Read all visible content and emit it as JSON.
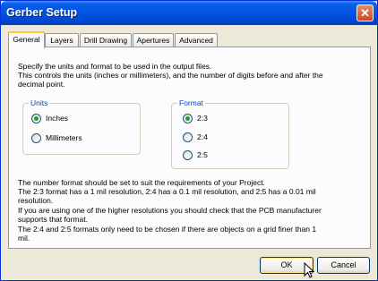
{
  "window": {
    "title": "Gerber Setup"
  },
  "tabs": [
    {
      "label": "General"
    },
    {
      "label": "Layers"
    },
    {
      "label": "Drill Drawing"
    },
    {
      "label": "Apertures"
    },
    {
      "label": "Advanced"
    }
  ],
  "general": {
    "intro_line1": "Specify the units and format to be used in the output files.",
    "intro_line2": "This controls the units (inches or millimeters), and the number of digits before and after the",
    "intro_line3": "decimal point.",
    "units": {
      "label": "Units",
      "options": [
        {
          "label": "Inches",
          "checked": true
        },
        {
          "label": "Millimeters",
          "checked": false
        }
      ]
    },
    "format": {
      "label": "Format",
      "options": [
        {
          "label": "2:3",
          "checked": true
        },
        {
          "label": "2:4",
          "checked": false
        },
        {
          "label": "2:5",
          "checked": false
        }
      ]
    },
    "info_lines": [
      "The number format should be set to suit the requirements of your Project.",
      "The 2:3 format has a 1 mil resolution, 2:4 has a 0.1 mil resolution, and 2:5 has a 0.01 mil",
      "resolution.",
      "If you are using one of the higher resolutions you should check that the PCB manufacturer",
      "supports that format.",
      "The 2:4 and 2:5 formats only need to be chosen if there are objects on a grid finer than 1",
      "mil."
    ]
  },
  "buttons": {
    "ok": "OK",
    "cancel": "Cancel"
  },
  "colors": {
    "titlebar": "#0054e3",
    "group_label": "#0046d5",
    "radio_dot": "#21a121",
    "active_tab_accent": "#ffc83c"
  }
}
